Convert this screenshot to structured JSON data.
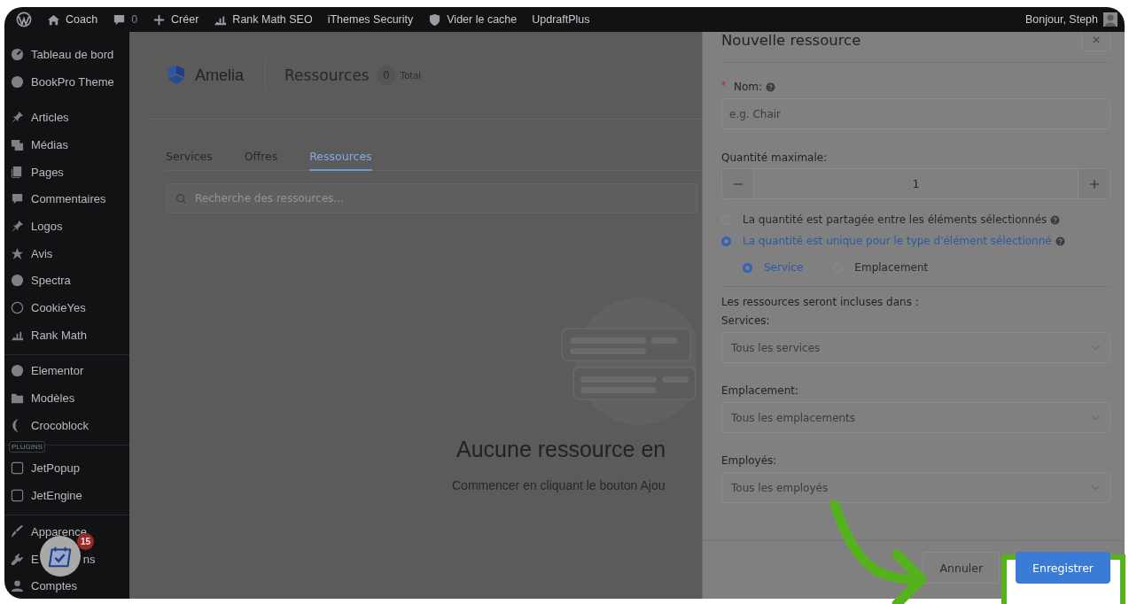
{
  "admin_bar": {
    "items": [
      {
        "label": "Coach"
      },
      {
        "label": "0"
      },
      {
        "label": "Créer"
      },
      {
        "label": "Rank Math SEO"
      },
      {
        "label": "iThemes Security"
      },
      {
        "label": "Vider le cache"
      },
      {
        "label": "UpdraftPlus"
      }
    ],
    "greeting": "Bonjour, Steph"
  },
  "sidebar": {
    "sections": [
      {
        "items": [
          {
            "label": "Tableau de bord"
          },
          {
            "label": "BookPro Theme"
          }
        ]
      },
      {
        "items": [
          {
            "label": "Articles"
          },
          {
            "label": "Médias"
          },
          {
            "label": "Pages"
          },
          {
            "label": "Commentaires"
          },
          {
            "label": "Logos"
          },
          {
            "label": "Avis"
          },
          {
            "label": "Spectra"
          },
          {
            "label": "CookieYes"
          },
          {
            "label": "Rank Math"
          }
        ]
      },
      {
        "items": [
          {
            "label": "Elementor"
          },
          {
            "label": "Modèles"
          },
          {
            "label": "Crocoblock"
          }
        ]
      },
      {
        "heading": "PLUGINS",
        "items": [
          {
            "label": "JetPopup"
          },
          {
            "label": "JetEngine"
          }
        ]
      },
      {
        "items": [
          {
            "label": "Apparence"
          },
          {
            "label": "E",
            "label_tail": "ns"
          },
          {
            "label": "Comptes"
          }
        ]
      }
    ]
  },
  "calendar_widget": {
    "badge": "15"
  },
  "app_header": {
    "brand": "Amelia",
    "title": "Ressources",
    "count": "0",
    "count_label": "Total"
  },
  "tabs": [
    {
      "label": "Services",
      "selected": false
    },
    {
      "label": "Offres",
      "selected": false
    },
    {
      "label": "Ressources",
      "selected": true
    }
  ],
  "search": {
    "placeholder": "Recherche des ressources..."
  },
  "empty_state": {
    "title": "Aucune ressource en",
    "text": "Commencer en cliquant le bouton Ajou"
  },
  "drawer": {
    "title": "Nouvelle ressource",
    "name_field": {
      "label": "Nom:",
      "required": true,
      "placeholder": "e.g. Chair"
    },
    "quantity": {
      "label": "Quantité maximale:",
      "value": "1"
    },
    "share_options": [
      {
        "label": "La quantité est partagée entre les éléments sélectionnés",
        "selected": false
      },
      {
        "label": "La quantité est unique pour le type d'élément sélectionné",
        "selected": true
      }
    ],
    "element_types": [
      {
        "label": "Service",
        "selected": true
      },
      {
        "label": "Emplacement",
        "selected": false
      }
    ],
    "includes_label": "Les ressources seront incluses dans :",
    "selects": [
      {
        "label": "Services:",
        "placeholder": "Tous les services"
      },
      {
        "label": "Emplacement:",
        "placeholder": "Tous les emplacements"
      },
      {
        "label": "Employés:",
        "placeholder": "Tous les employés"
      }
    ],
    "buttons": [
      {
        "kind": "secondary",
        "label": "Annuler"
      },
      {
        "kind": "primary",
        "label": "Enregistrer"
      }
    ]
  }
}
